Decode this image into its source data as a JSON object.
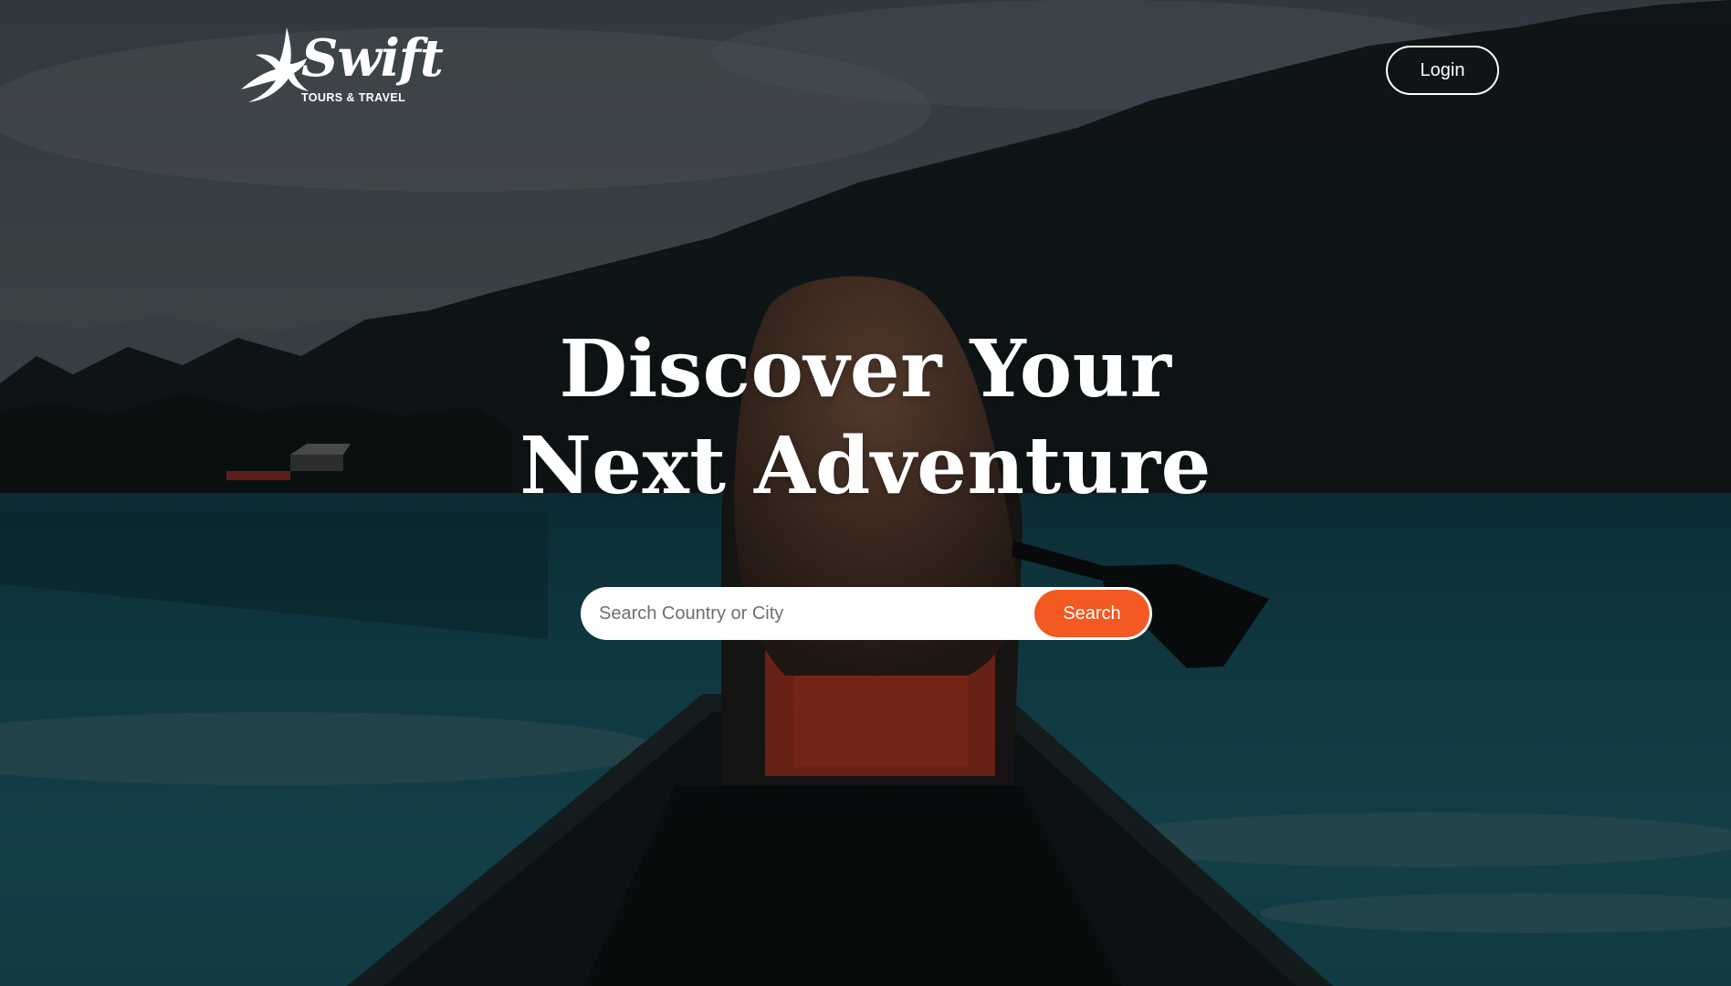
{
  "brand": {
    "name": "Swift",
    "tagline": "TOURS & TRAVEL",
    "logo_icon": "swallow-bird-icon"
  },
  "header": {
    "login_label": "Login"
  },
  "hero": {
    "headline_line1": "Discover Your",
    "headline_line2": "Next Adventure"
  },
  "search": {
    "placeholder": "Search Country or City",
    "value": "",
    "button_label": "Search"
  },
  "colors": {
    "accent": "#f25a22",
    "text_on_hero": "#ffffff",
    "search_background": "#ffffff"
  }
}
